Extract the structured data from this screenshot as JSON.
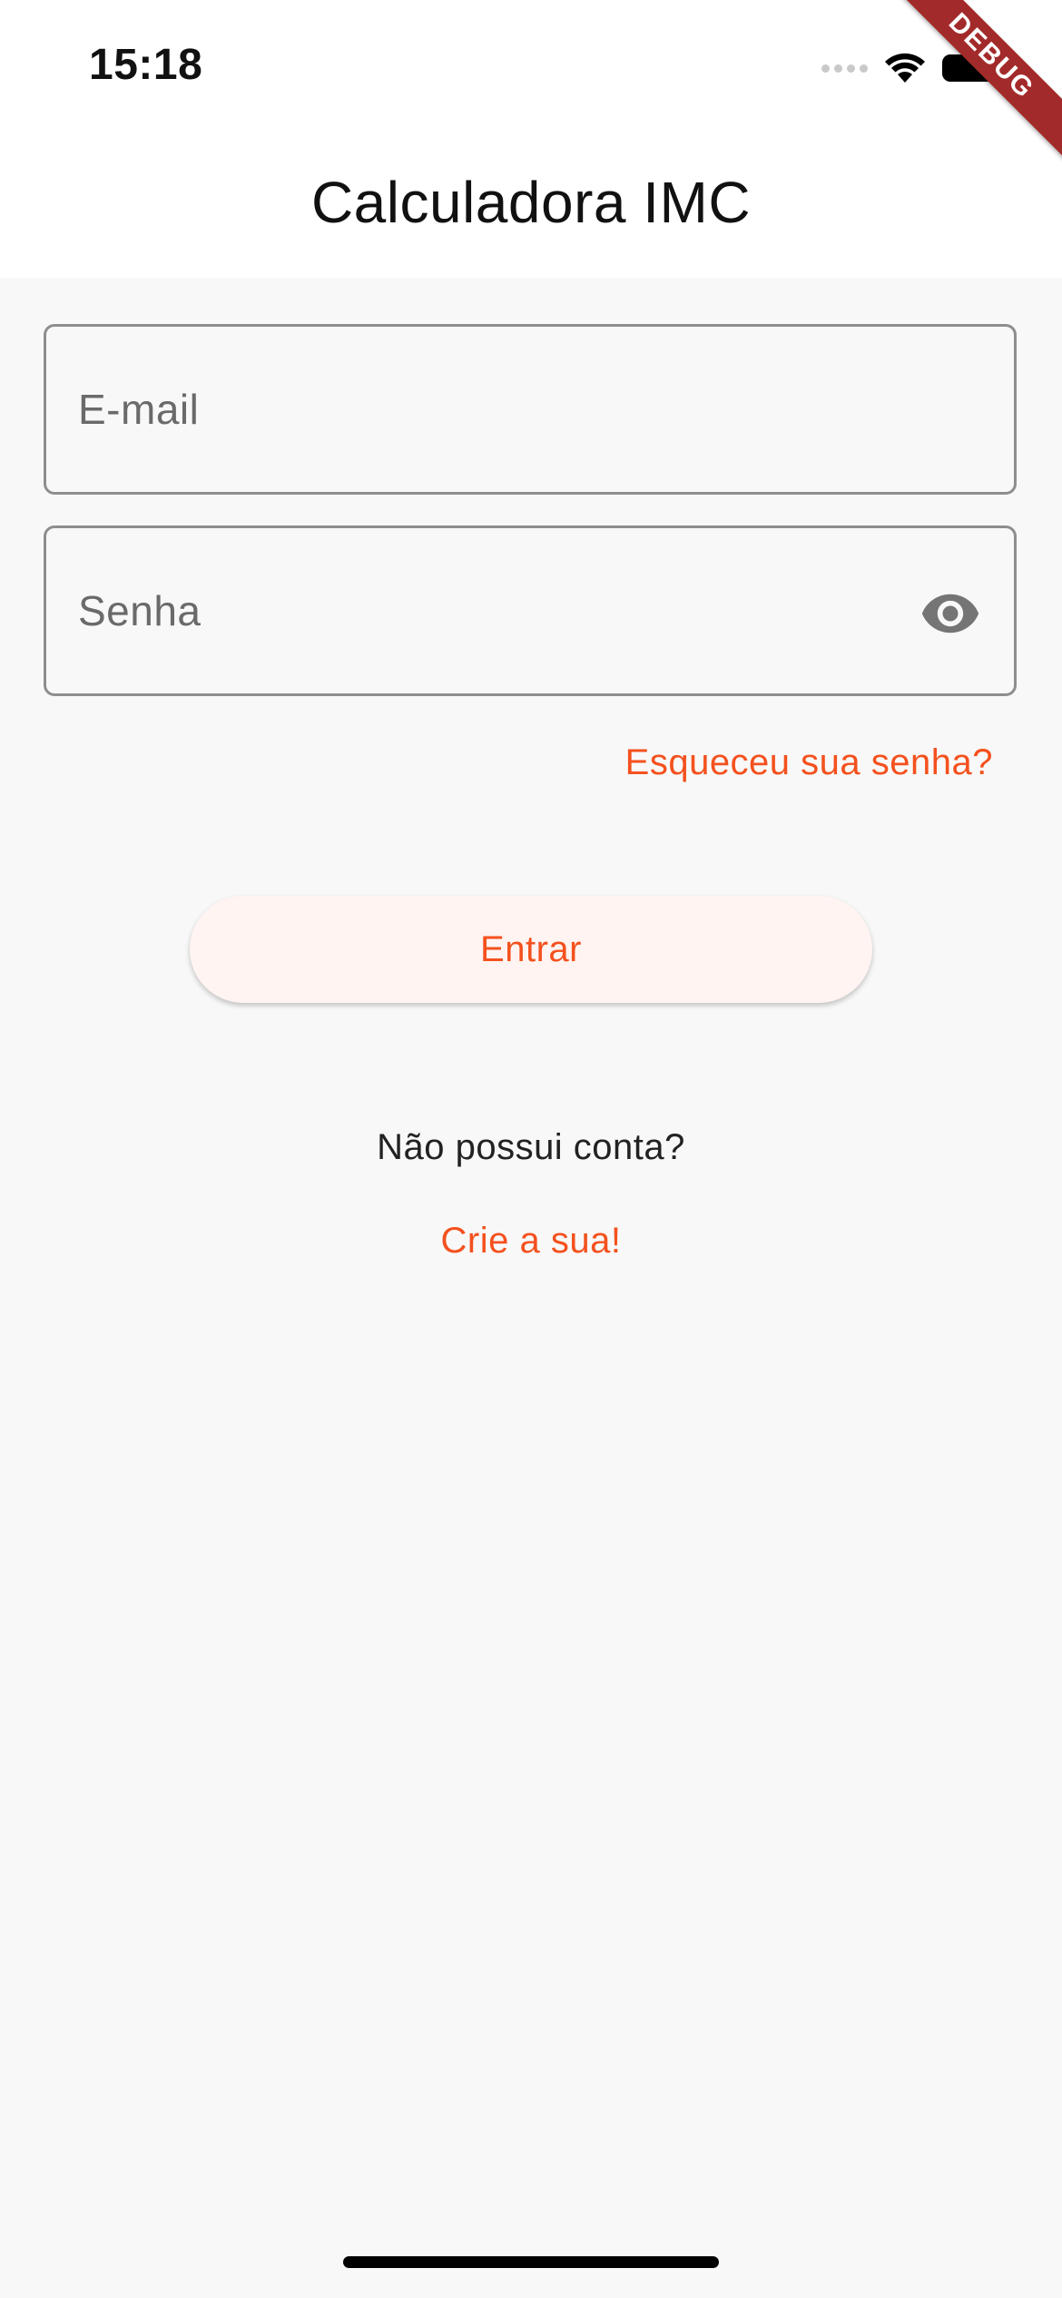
{
  "status_bar": {
    "time": "15:18",
    "icons": [
      "cellular-signal-icon",
      "wifi-icon",
      "battery-icon"
    ]
  },
  "debug_banner": "DEBUG",
  "app_bar": {
    "title": "Calculadora IMC"
  },
  "form": {
    "email": {
      "placeholder": "E-mail",
      "value": ""
    },
    "password": {
      "placeholder": "Senha",
      "value": "",
      "toggle_icon": "eye-icon"
    },
    "forgot_password": "Esqueceu sua senha?",
    "submit_label": "Entrar"
  },
  "signup": {
    "prompt": "Não possui conta?",
    "link": "Crie a sua!"
  },
  "colors": {
    "accent": "#f4511e",
    "button_bg": "#fff4f1",
    "background": "#f8f8f8",
    "app_bar_bg": "#ffffff",
    "field_border": "#8e8e8e"
  }
}
